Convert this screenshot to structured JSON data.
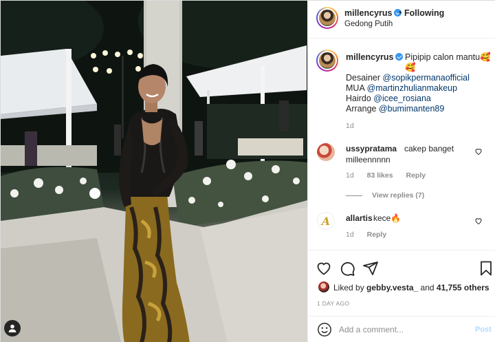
{
  "header": {
    "username": "millencyrus",
    "separator": "•",
    "follow_status": "Following",
    "location": "Gedong Putih"
  },
  "caption": {
    "username": "millencyrus",
    "text": "Pipipip calon mantu🥰🥰",
    "lines": [
      {
        "label": "Desainer ",
        "mention": "@sopikpermanaofficial"
      },
      {
        "label": "MUA ",
        "mention": "@martinzhulianmakeup"
      },
      {
        "label": "Hairdo ",
        "mention": "@icee_rosiana"
      },
      {
        "label": "Arrange ",
        "mention": "@bumimanten89"
      }
    ],
    "time": "1d"
  },
  "comments": [
    {
      "username": "ussypratama",
      "text_line1": "cakep banget",
      "text_line2": "milleennnnn",
      "time": "1d",
      "likes": "83 likes",
      "reply_label": "Reply",
      "view_replies": "View replies (7)"
    },
    {
      "username": "allartis",
      "text": "kece🔥",
      "time": "1d",
      "reply_label": "Reply"
    }
  ],
  "likes": {
    "prefix": "Liked by ",
    "user": "gebby.vesta_",
    "middle": " and ",
    "count": "41,755 others"
  },
  "post_date": "1 DAY AGO",
  "add_comment": {
    "placeholder": "Add a comment...",
    "post_label": "Post"
  },
  "icons": {
    "verified": "verified-badge-icon",
    "heart": "heart-icon",
    "comment": "comment-icon",
    "share": "share-icon",
    "save": "bookmark-icon",
    "emoji": "emoji-icon",
    "user": "user-tag-icon"
  },
  "colors": {
    "verified_blue": "#3897f0",
    "mention_blue": "#00376b",
    "post_button": "#b3dbff",
    "muted": "#8e8e8e"
  }
}
